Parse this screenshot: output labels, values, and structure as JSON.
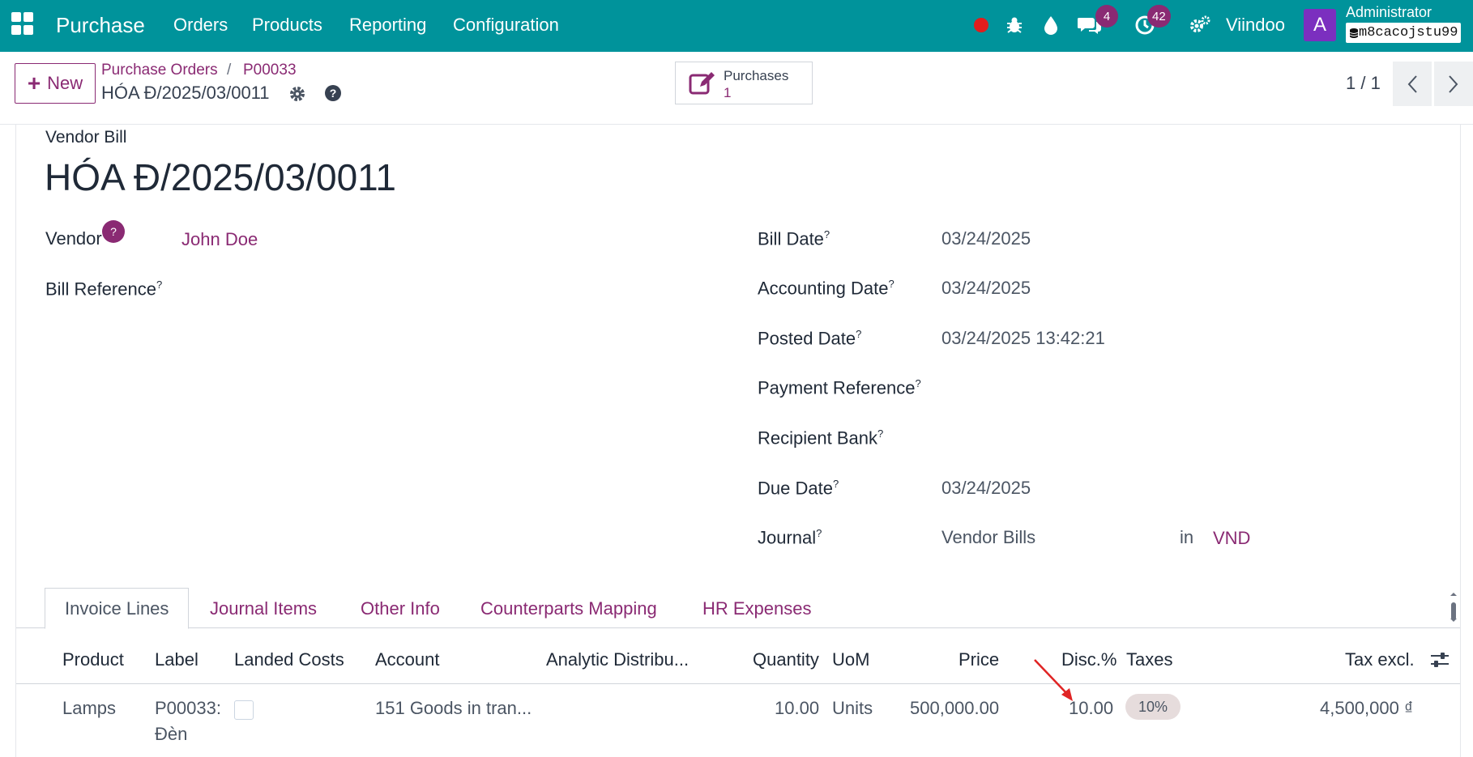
{
  "navbar": {
    "app_name": "Purchase",
    "menu": [
      "Orders",
      "Products",
      "Reporting",
      "Configuration"
    ],
    "chat_count": "4",
    "activity_count": "42",
    "company": "Viindoo",
    "avatar_letter": "A",
    "user_name": "Administrator",
    "database": "m8cacojstu99",
    "icons": [
      "apps-grid-icon",
      "record-dot-icon",
      "bug-icon",
      "droplet-icon",
      "chat-icon",
      "clock-icon",
      "settings-gears-icon"
    ],
    "colors": {
      "bar": "#00939b",
      "accent": "#8a2a73",
      "record": "#e11d1d",
      "avatar": "#7b2fbf"
    }
  },
  "control": {
    "new_label": "New",
    "breadcrumb": [
      "Purchase Orders",
      "P00033"
    ],
    "separator": "/",
    "current": "HÓA Đ/2025/03/0011",
    "smart_button": {
      "label": "Purchases",
      "count": "1"
    },
    "pager": "1 / 1"
  },
  "form": {
    "doc_type": "Vendor Bill",
    "name": "HÓA Đ/2025/03/0011",
    "left_fields": {
      "vendor_label": "Vendor",
      "vendor_value": "John Doe",
      "bill_reference_label": "Bill Reference"
    },
    "right_fields": [
      {
        "label": "Bill Date",
        "value": "03/24/2025"
      },
      {
        "label": "Accounting Date",
        "value": "03/24/2025"
      },
      {
        "label": "Posted Date",
        "value": "03/24/2025 13:42:21"
      },
      {
        "label": "Payment Reference",
        "value": ""
      },
      {
        "label": "Recipient Bank",
        "value": ""
      },
      {
        "label": "Due Date",
        "value": "03/24/2025"
      },
      {
        "label": "Journal",
        "value": "Vendor Bills"
      }
    ],
    "journal_in": "in",
    "currency": "VND",
    "help_mark": "?"
  },
  "tabs": [
    "Invoice Lines",
    "Journal Items",
    "Other Info",
    "Counterparts Mapping",
    "HR Expenses"
  ],
  "table": {
    "columns": [
      "Product",
      "Label",
      "Landed Costs",
      "Account",
      "Analytic Distribu...",
      "Quantity",
      "UoM",
      "Price",
      "Disc.%",
      "Taxes",
      "Tax excl."
    ],
    "rows": [
      {
        "product": "Lamps",
        "label_line1": "P00033:",
        "label_line2": "Đèn",
        "landed_costs": false,
        "account": "151 Goods in tran...",
        "analytic": "",
        "quantity": "10.00",
        "uom": "Units",
        "price": "500,000.00",
        "discount": "10.00",
        "taxes": "10%",
        "tax_excl": "4,500,000 ₫"
      }
    ]
  }
}
